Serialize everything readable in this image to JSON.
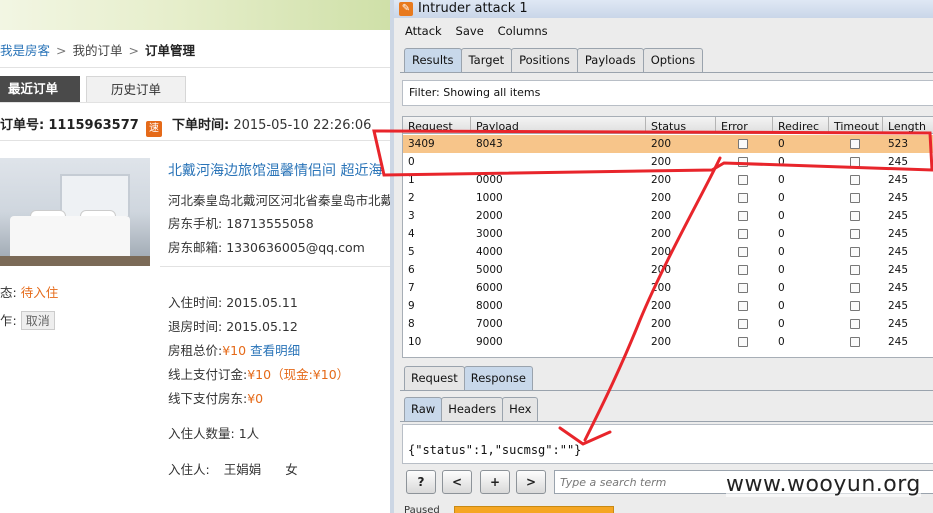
{
  "web": {
    "breadcrumb": {
      "home": "我是房客",
      "sep": ">",
      "my_orders": "我的订单",
      "current": "订单管理"
    },
    "tabs": {
      "recent": "最近订单",
      "history": "历史订单"
    },
    "order": {
      "no_label": "订单号:",
      "no_value": "1115963577",
      "badge": "速",
      "time_label": "下单时间:",
      "time_value": "2015-05-10 22:26:06"
    },
    "hotel": {
      "title": "北戴河海边旅馆温馨情侣间 超近海",
      "address": "河北秦皇岛北戴河区河北省秦皇岛市北戴",
      "phone_label": "房东手机:",
      "phone_value": "18713555058",
      "email_label": "房东邮箱:",
      "email_value": "1330636005@qq.com"
    },
    "status": {
      "label": "态:",
      "value": "待入住"
    },
    "operation": {
      "label": "乍:",
      "cancel": "取消"
    },
    "details": {
      "checkin_label": "入住时间:",
      "checkin_value": "2015.05.11",
      "checkout_label": "退房时间:",
      "checkout_value": "2015.05.12",
      "total_label": "房租总价:",
      "total_value": "¥10",
      "total_link": "查看明细",
      "online_label": "线上支付订金:",
      "online_value": "¥10（现金:¥10）",
      "offline_label": "线下支付房东:",
      "offline_value": "¥0",
      "guests_label": "入住人数量:",
      "guests_value": "1人",
      "guest_label": "入住人:",
      "guest_name": "王娟娟",
      "guest_gender": "女"
    }
  },
  "burp": {
    "title": "Intruder attack 1",
    "title_icon": "burp-logo-icon",
    "menu": [
      "Attack",
      "Save",
      "Columns"
    ],
    "tabs": [
      "Results",
      "Target",
      "Positions",
      "Payloads",
      "Options"
    ],
    "active_tab": "Results",
    "filter": "Filter: Showing all items",
    "columns": [
      "Request",
      "Payload",
      "Status",
      "Error",
      "Redirec",
      "Timeout",
      "Length"
    ],
    "rows": [
      {
        "request": "3409",
        "payload": "8043",
        "status": "200",
        "redirect": "0",
        "length": "523",
        "selected": true
      },
      {
        "request": "0",
        "payload": "",
        "status": "200",
        "redirect": "0",
        "length": "245"
      },
      {
        "request": "1",
        "payload": "0000",
        "status": "200",
        "redirect": "0",
        "length": "245"
      },
      {
        "request": "2",
        "payload": "1000",
        "status": "200",
        "redirect": "0",
        "length": "245"
      },
      {
        "request": "3",
        "payload": "2000",
        "status": "200",
        "redirect": "0",
        "length": "245"
      },
      {
        "request": "4",
        "payload": "3000",
        "status": "200",
        "redirect": "0",
        "length": "245"
      },
      {
        "request": "5",
        "payload": "4000",
        "status": "200",
        "redirect": "0",
        "length": "245"
      },
      {
        "request": "6",
        "payload": "5000",
        "status": "200",
        "redirect": "0",
        "length": "245"
      },
      {
        "request": "7",
        "payload": "6000",
        "status": "200",
        "redirect": "0",
        "length": "245"
      },
      {
        "request": "9",
        "payload": "8000",
        "status": "200",
        "redirect": "0",
        "length": "245"
      },
      {
        "request": "8",
        "payload": "7000",
        "status": "200",
        "redirect": "0",
        "length": "245"
      },
      {
        "request": "10",
        "payload": "9000",
        "status": "200",
        "redirect": "0",
        "length": "245"
      }
    ],
    "req_resp_tabs": [
      "Request",
      "Response"
    ],
    "active_req_resp": "Response",
    "view_tabs": [
      "Raw",
      "Headers",
      "Hex"
    ],
    "active_view": "Raw",
    "response_body": "{\"status\":1,\"sucmsg\":\"\"}",
    "buttons": {
      "help": "?",
      "prev": "<",
      "next_plus": "+",
      "next": ">"
    },
    "search_placeholder": "Type a search term",
    "status_label": "Paused",
    "progress": 0.55
  },
  "watermark": "www.wooyun.org",
  "colors": {
    "annotation": "#e8252b",
    "selected_row": "#f7c58a",
    "accent_orange": "#e56a19",
    "link_blue": "#2a74b8"
  }
}
